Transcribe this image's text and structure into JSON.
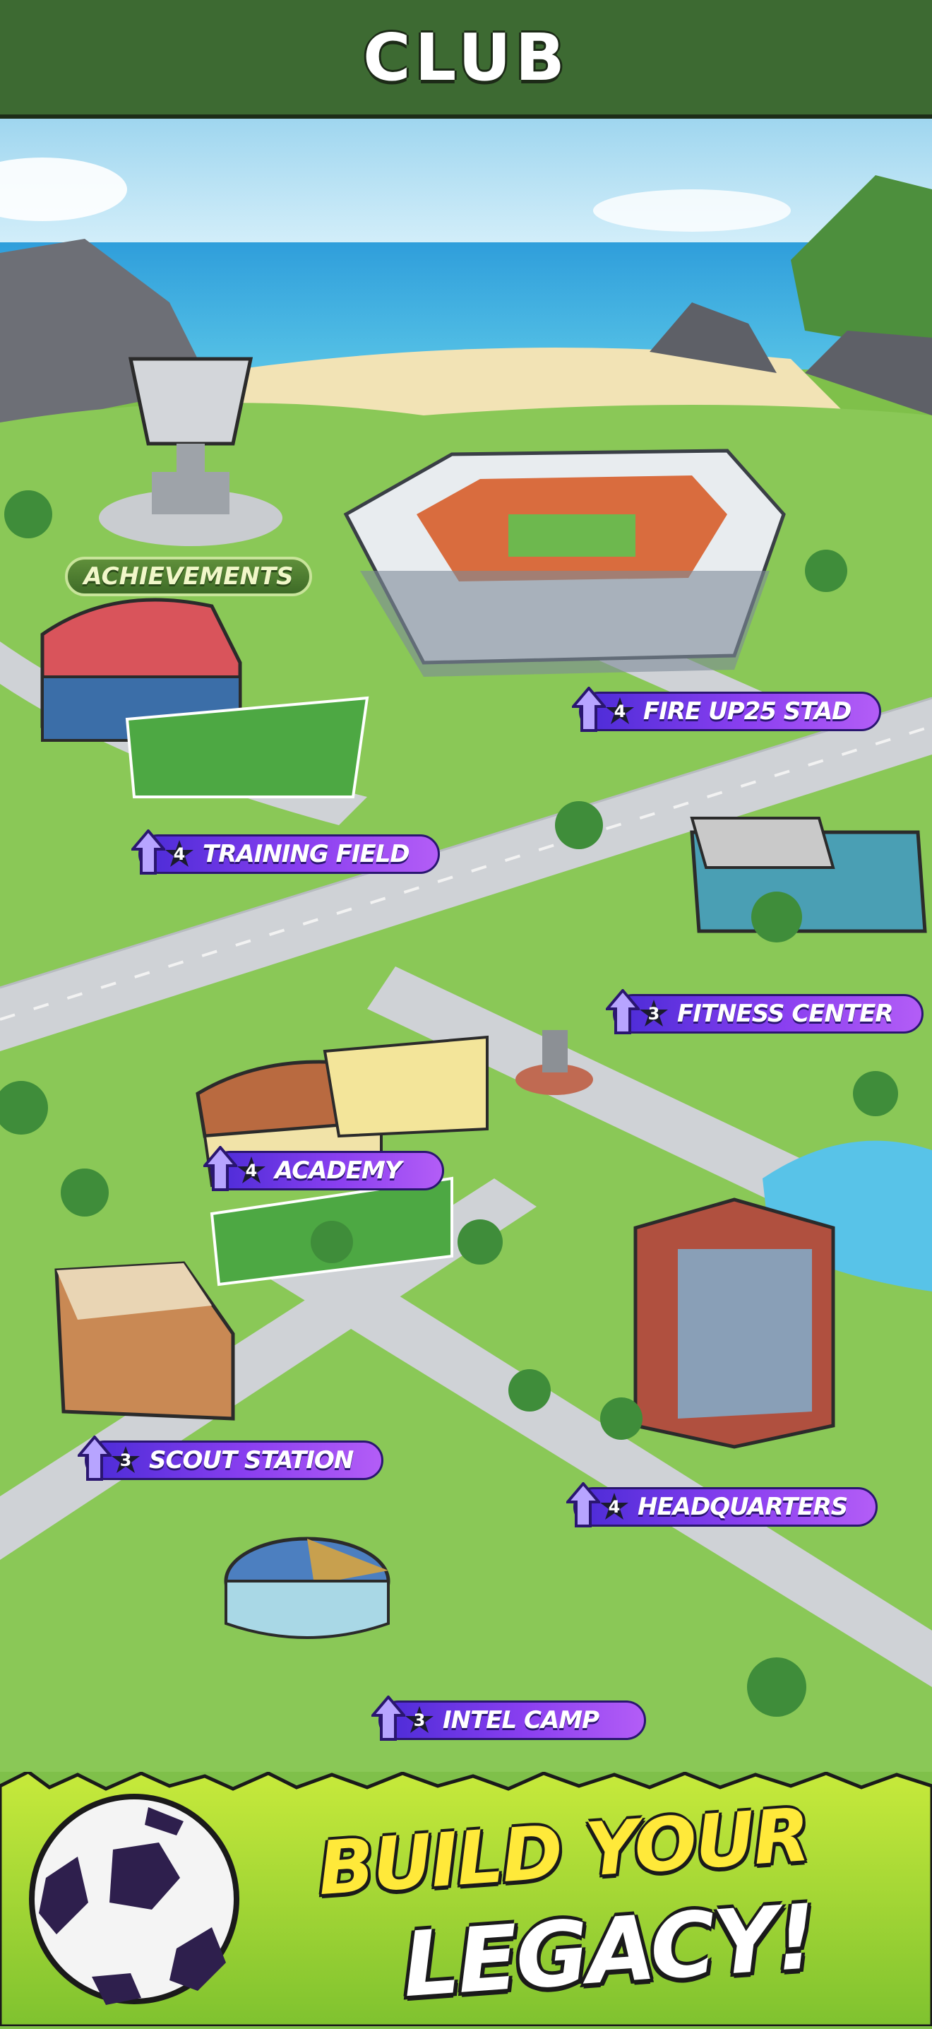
{
  "header": {
    "title": "CLUB"
  },
  "map": {
    "achievements": "ACHIEVEMENTS",
    "buildings": [
      {
        "id": "stadium",
        "name": "FIRE UP25 STAD",
        "level": "4"
      },
      {
        "id": "training-field",
        "name": "TRAINING FIELD",
        "level": "4"
      },
      {
        "id": "fitness-center",
        "name": "FITNESS CENTER",
        "level": "3"
      },
      {
        "id": "academy",
        "name": "ACADEMY",
        "level": "4"
      },
      {
        "id": "scout-station",
        "name": "SCOUT STATION",
        "level": "3"
      },
      {
        "id": "headquarters",
        "name": "HEADQUARTERS",
        "level": "4"
      },
      {
        "id": "intel-camp",
        "name": "INTEL CAMP",
        "level": "3"
      }
    ]
  },
  "footer": {
    "slogan_line1": "BUILD YOUR",
    "slogan_line2": "LEGACY!"
  },
  "colors": {
    "header": "#3d6a32",
    "label_pill": "#8a3ff0",
    "upgrade_arrow": "#b7a4ff",
    "grass": "#7fc04a",
    "road": "#cfd2d6",
    "sea": "#2fa3dc",
    "slogan": "#ffe93a"
  },
  "icons": [
    "upgrade-arrow-icon",
    "level-star-icon",
    "trophy-icon",
    "soccer-ball-icon"
  ]
}
